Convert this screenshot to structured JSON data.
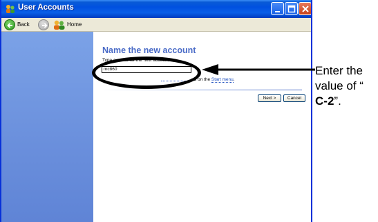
{
  "window": {
    "title": "User Accounts"
  },
  "toolbar": {
    "back_label": "Back",
    "home_label": "Home"
  },
  "content": {
    "heading": "Name the new account",
    "prompt": "Type a name for the new account:",
    "input_value": "mc860",
    "note_text": "nd on the ",
    "start_menu_link": "Start menu",
    "note_end": ".",
    "next_label": "Next >",
    "cancel_label": "Cancel"
  },
  "annotation": {
    "line1": "Enter the",
    "line2": "value of “",
    "line3_bold": "C-2",
    "line3_rest": "”."
  },
  "colors": {
    "title_bar": "#0050e0",
    "sidebar": "#6a8fdc",
    "heading": "#4a6bc7",
    "callout": "#000000"
  },
  "icons": {
    "app": "user-accounts-icon",
    "back": "back-arrow-icon",
    "forward": "forward-arrow-icon",
    "home": "home-users-icon",
    "minimize": "minimize-icon",
    "maximize": "maximize-icon",
    "close": "close-icon"
  }
}
